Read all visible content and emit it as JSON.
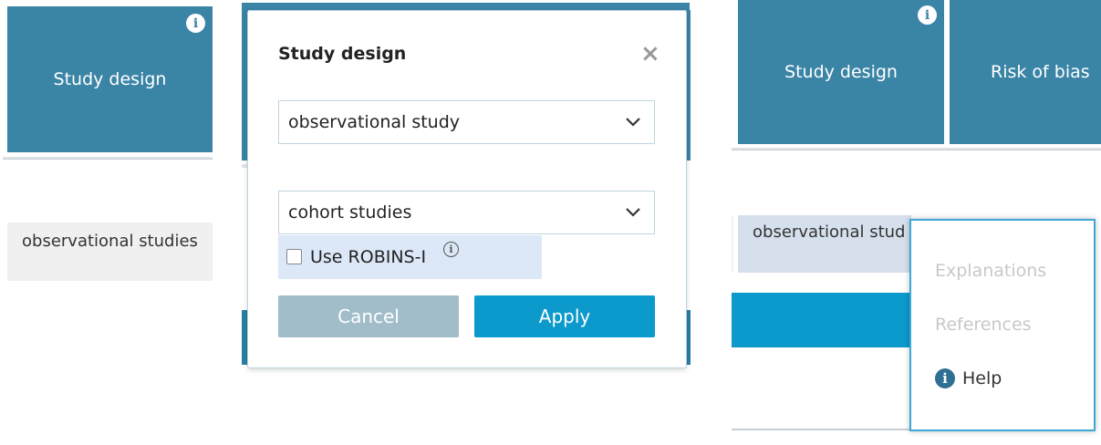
{
  "left_panel": {
    "tile_title": "Study design",
    "info_glyph": "i",
    "cell_text": "observational studies"
  },
  "modal": {
    "title": "Study design",
    "close_glyph": "×",
    "select_type": {
      "value": "observational study"
    },
    "select_subtype": {
      "value": "cohort studies"
    },
    "checkbox_label": "Use ROBINS-I",
    "checkbox_checked": false,
    "info_glyph": "i",
    "cancel_label": "Cancel",
    "apply_label": "Apply"
  },
  "right_panel": {
    "tile_study": "Study design",
    "tile_bias": "Risk of bias",
    "info_glyph": "i",
    "cell_text": "observational stud",
    "menu": {
      "explanations": "Explanations",
      "references": "References",
      "help": "Help",
      "help_glyph": "i"
    }
  },
  "colors": {
    "tile": "#3a84a6",
    "apply": "#0b9acb",
    "cancel": "#a1bdc9",
    "menu_border": "#3ea7d4",
    "checkbox_area": "#dce8f7",
    "obs_cell": "#d5e0ec"
  },
  "icons": [
    "info-icon",
    "close-icon",
    "chevron-down-icon",
    "help-icon"
  ]
}
